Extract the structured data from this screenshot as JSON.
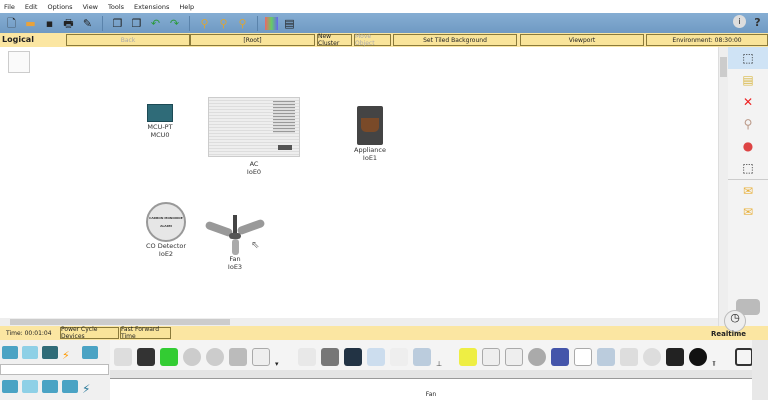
{
  "menu": [
    "File",
    "Edit",
    "Options",
    "View",
    "Tools",
    "Extensions",
    "Help"
  ],
  "toolbar": {
    "icons": [
      "new-file-icon",
      "open-folder-icon",
      "save-icon",
      "print-icon",
      "activity-wizard-icon",
      "copy-icon",
      "paste-icon",
      "undo-icon",
      "redo-icon",
      "zoom-in-icon",
      "zoom-reset-icon",
      "zoom-out-icon",
      "palette-icon",
      "custom-device-icon"
    ],
    "info_icon": "i",
    "help_icon": "?"
  },
  "logical_bar": {
    "label": "Logical",
    "back": "Back",
    "root": "[Root]",
    "new_cluster": "New Cluster",
    "move_object": "Move Object",
    "set_tiled_background": "Set Tiled Background",
    "viewport": "Viewport",
    "environment": "Environment: 08:30:00"
  },
  "devices": [
    {
      "type": "MCU-PT",
      "name": "MCU0"
    },
    {
      "type": "AC",
      "name": "IoE0"
    },
    {
      "type": "Appliance",
      "name": "IoE1"
    },
    {
      "type": "CO Detector",
      "name": "IoE2"
    },
    {
      "type": "Fan",
      "name": "IoE3"
    }
  ],
  "co_label": "CARBON MONOXIDE ALARM",
  "right_panel": [
    "select-icon",
    "note-icon",
    "delete-icon",
    "inspect-icon",
    "draw-shape-icon",
    "resize-icon",
    "add-simple-pdu-icon",
    "add-complex-pdu-icon"
  ],
  "time_bar": {
    "time": "Time: 00:01:04",
    "power_cycle": "Power Cycle Devices",
    "fast_forward": "Fast Forward Time",
    "mode": "Realtime"
  },
  "device_list_selected": "Fan",
  "colors": {
    "toolbar": "#7aa3ca",
    "yellow_bar": "#fbe6a2",
    "accent": "#8ed0e6"
  }
}
